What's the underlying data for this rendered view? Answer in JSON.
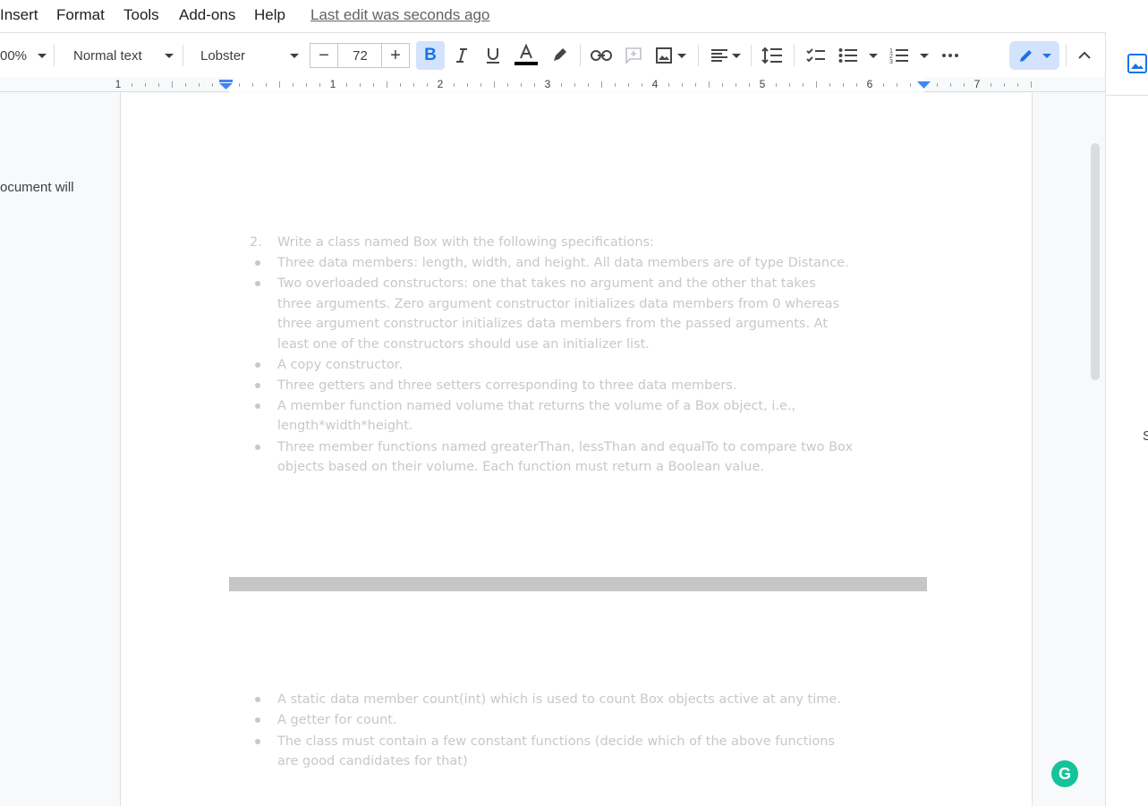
{
  "menu": {
    "items": [
      "Insert",
      "Format",
      "Tools",
      "Add-ons",
      "Help"
    ],
    "last_edit": "Last edit was seconds ago"
  },
  "toolbar": {
    "zoom": "00%",
    "style": "Normal text",
    "font": "Lobster",
    "font_size": "72",
    "minus": "−",
    "plus": "+",
    "bold": "B"
  },
  "ruler": {
    "numbers": [
      "1",
      "1",
      "2",
      "3",
      "4",
      "5",
      "6",
      "7"
    ]
  },
  "left_pane": {
    "text": "ocument will"
  },
  "document": {
    "heading_number": "2.",
    "heading": "Write a class named Box with the following specifications:",
    "bullets_1": [
      [
        "Three data members: length, width, and height. All data members are of type Distance."
      ],
      [
        "Two overloaded constructors: one that takes no argument and the other that takes",
        "three arguments. Zero argument constructor initializes data members from 0 whereas",
        "three argument constructor initializes data members from the passed arguments. At",
        "least one of the constructors should use an initializer list."
      ],
      [
        "A copy constructor."
      ],
      [
        "Three getters and three setters corresponding to three data members."
      ],
      [
        "A member function named volume that returns the volume of a Box object, i.e.,",
        "length*width*height."
      ],
      [
        "Three member functions named greaterThan, lessThan and equalTo to compare two Box",
        "objects based on their volume. Each function must return a Boolean value."
      ]
    ],
    "bullets_2": [
      [
        "A static data member count(int) which is used to count Box objects active at any time."
      ],
      [
        "A getter for count."
      ],
      [
        "The class must contain a few constant functions (decide which of the above functions",
        "are good candidates for that)"
      ]
    ]
  },
  "side_panel": {
    "letter": "S"
  },
  "grammarly": {
    "label": "G"
  },
  "colors": {
    "accent": "#1a73e8",
    "faded_text": "#c8c8c8",
    "grammarly": "#15c39a"
  }
}
